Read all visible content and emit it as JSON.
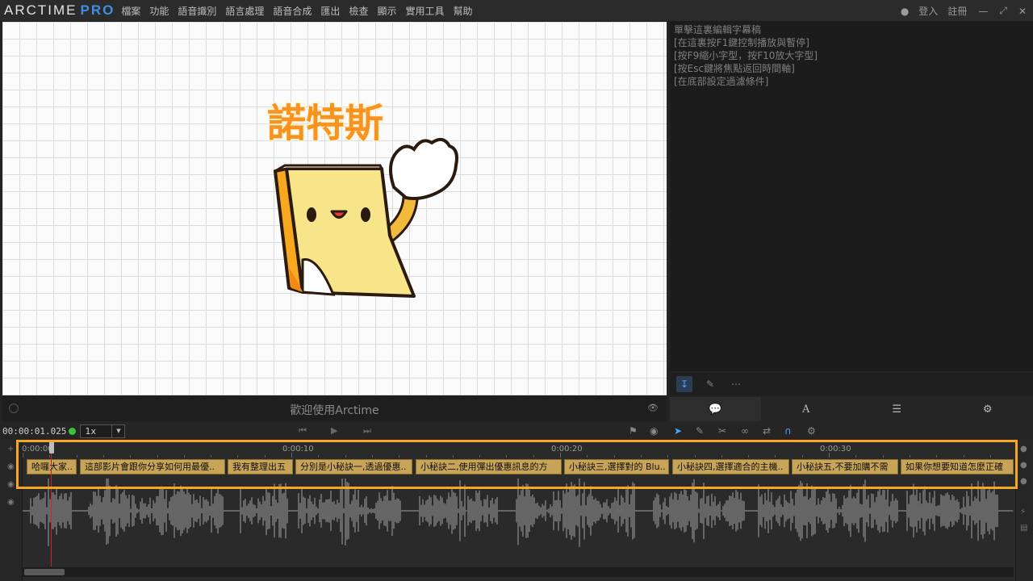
{
  "app": {
    "logo_main": "ARCTIME",
    "logo_pro": "PRO"
  },
  "menu": {
    "items": [
      "檔案",
      "功能",
      "語音識別",
      "語言處理",
      "語音合成",
      "匯出",
      "檢查",
      "顯示",
      "實用工具",
      "幫助"
    ],
    "login": "登入",
    "register": "註冊"
  },
  "preview": {
    "title_text": "諾特斯",
    "subtitle": "歡迎使用Arctime"
  },
  "editor": {
    "lines": [
      "單擊這裏編輯字幕稿",
      "[在這裏按F1鍵控制播放與暫停]",
      "[按F9縮小字型，按F10放大字型]",
      "[按Esc鍵將焦點返回時間軸]",
      "[在底部設定過濾條件]"
    ]
  },
  "transport": {
    "timecode": "00:00:01.025",
    "speed": "1x"
  },
  "timeline": {
    "ticks": [
      "0:00:00",
      "0:00:10",
      "0:00:20",
      "0:00:30"
    ],
    "subtitles": [
      "哈囉大家..",
      "這部影片會跟你分享如何用最優..",
      "我有整理出五",
      "分別是小秘訣一,透過優惠..",
      "小秘訣二,使用彈出優惠訊息的方",
      "小秘訣三,選擇對的 Blu..",
      "小秘訣四,選擇適合的主機..",
      "小秘訣五,不要加購不需",
      "如果你想要知道怎麼正確"
    ]
  }
}
